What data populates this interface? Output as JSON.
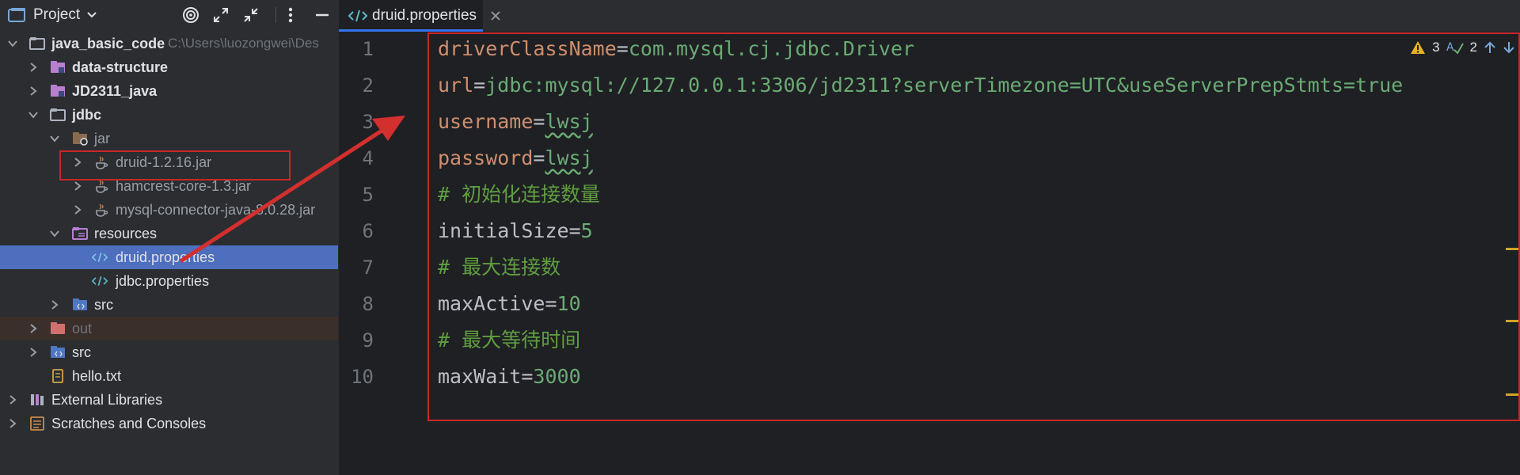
{
  "project_panel": {
    "title": "Project",
    "tree": [
      {
        "label": "java_basic_code",
        "extra": "C:\\Users\\luozongwei\\Des"
      },
      {
        "label": "data-structure"
      },
      {
        "label": "JD2311_java"
      },
      {
        "label": "jdbc"
      },
      {
        "label": "jar"
      },
      {
        "label": "druid-1.2.16.jar"
      },
      {
        "label": "hamcrest-core-1.3.jar"
      },
      {
        "label": "mysql-connector-java-8.0.28.jar"
      },
      {
        "label": "resources"
      },
      {
        "label": "druid.properties"
      },
      {
        "label": "jdbc.properties"
      },
      {
        "label": "src"
      },
      {
        "label": "out"
      },
      {
        "label": "src"
      },
      {
        "label": "hello.txt"
      },
      {
        "label": "External Libraries"
      },
      {
        "label": "Scratches and Consoles"
      }
    ]
  },
  "editor": {
    "tab_label": "druid.properties",
    "warnings_count": "3",
    "typos_count": "2",
    "lines": [
      {
        "num": "1",
        "key": "driverClassName",
        "eq": "=",
        "value": "com.mysql.cj.jdbc.Driver"
      },
      {
        "num": "2",
        "key": "url",
        "eq": "=",
        "value": "jdbc:mysql://127.0.0.1:3306/jd2311?serverTimezone=UTC&useServerPrepStmts=true"
      },
      {
        "num": "3",
        "key": "username",
        "eq": "=",
        "value": "lwsj"
      },
      {
        "num": "4",
        "key": "password",
        "eq": "=",
        "value": "lwsj"
      },
      {
        "num": "5",
        "comment": "# 初始化连接数量"
      },
      {
        "num": "6",
        "key": "initialSize",
        "eq": "=",
        "value": "5"
      },
      {
        "num": "7",
        "comment": "# 最大连接数"
      },
      {
        "num": "8",
        "key": "maxActive",
        "eq": "=",
        "value": "10"
      },
      {
        "num": "9",
        "comment": "# 最大等待时间"
      },
      {
        "num": "10",
        "key": "maxWait",
        "eq": "=",
        "value": "3000"
      }
    ]
  },
  "colors": {
    "accent": "#3574f0",
    "selection": "#4d6fbe",
    "annotation_red": "#c62828",
    "key": "#cf8e6d",
    "value": "#6aab73",
    "comment": "#5f9e40"
  }
}
